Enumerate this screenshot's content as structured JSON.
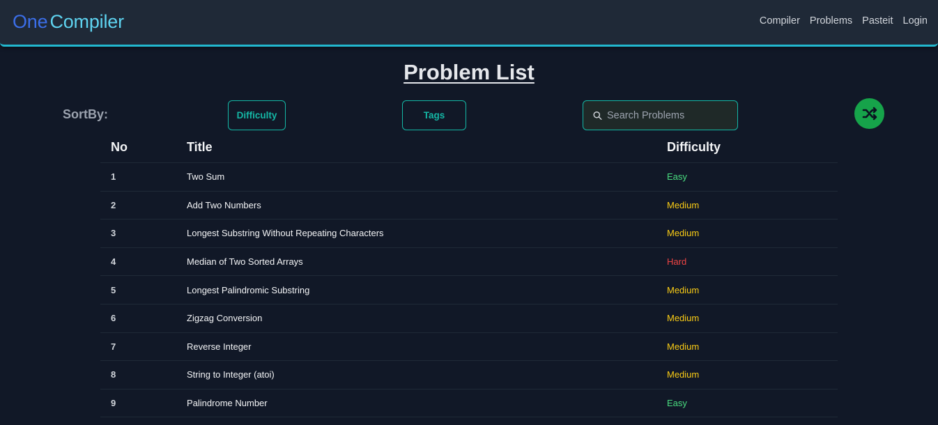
{
  "brand": {
    "part1": "One",
    "part2": "Compiler"
  },
  "nav": [
    "Compiler",
    "Problems",
    "Pasteit",
    "Login"
  ],
  "page_title": "Problem List",
  "sort_label": "SortBy:",
  "buttons": {
    "difficulty": "Difficulty",
    "tags": "Tags"
  },
  "search": {
    "placeholder": "Search Problems",
    "value": ""
  },
  "table": {
    "headers": [
      "No",
      "Title",
      "Difficulty"
    ],
    "rows": [
      {
        "no": "1",
        "title": "Two Sum",
        "difficulty": "Easy"
      },
      {
        "no": "2",
        "title": "Add Two Numbers",
        "difficulty": "Medium"
      },
      {
        "no": "3",
        "title": "Longest Substring Without Repeating Characters",
        "difficulty": "Medium"
      },
      {
        "no": "4",
        "title": "Median of Two Sorted Arrays",
        "difficulty": "Hard"
      },
      {
        "no": "5",
        "title": "Longest Palindromic Substring",
        "difficulty": "Medium"
      },
      {
        "no": "6",
        "title": "Zigzag Conversion",
        "difficulty": "Medium"
      },
      {
        "no": "7",
        "title": "Reverse Integer",
        "difficulty": "Medium"
      },
      {
        "no": "8",
        "title": "String to Integer (atoi)",
        "difficulty": "Medium"
      },
      {
        "no": "9",
        "title": "Palindrome Number",
        "difficulty": "Easy"
      }
    ]
  },
  "colors": {
    "background": "#111827",
    "navbar": "#1f2937",
    "accent_teal": "#14b8a6",
    "shuffle_green": "#16a34a",
    "easy": "#4ade80",
    "medium": "#facc15",
    "hard": "#ef4444"
  },
  "icons": {
    "search": "search-icon",
    "shuffle": "shuffle-icon"
  }
}
